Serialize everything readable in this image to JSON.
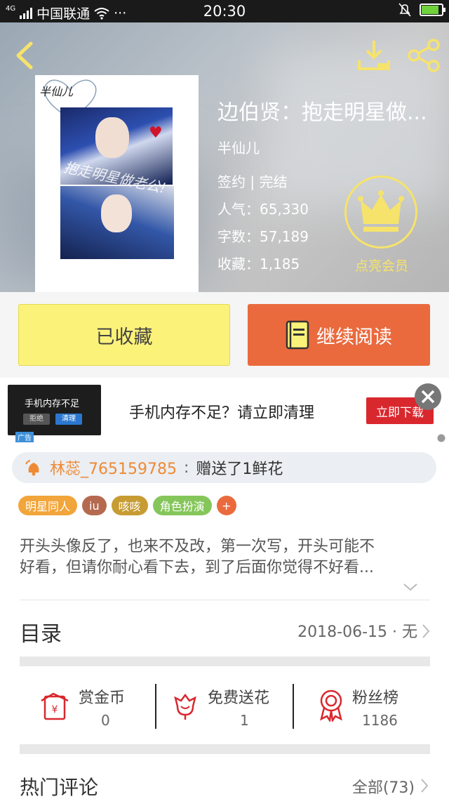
{
  "status_bar": {
    "carrier": "中国联通",
    "network": "4G",
    "time": "20:30",
    "dots": "···",
    "battery_level": 0.8
  },
  "book": {
    "title": "边伯贤：抱走明星做...",
    "author": "半仙儿",
    "status": "签约 | 完结",
    "popularity": "人气：65,330",
    "word_count": "字数：57,189",
    "favorites": "收藏：1,185",
    "cover_author": "半仙儿",
    "cover_overlay": "抱走明星做老公!"
  },
  "vip": {
    "label": "点亮会员",
    "color": "#f6e36b"
  },
  "actions": {
    "favorited_label": "已收藏",
    "continue_label": "继续阅读"
  },
  "ad": {
    "image_title": "手机内存不足",
    "image_btn_reject": "拒绝",
    "image_btn_clean": "清理",
    "tag": "广告",
    "text": "手机内存不足？请立即清理",
    "cta": "立即下载"
  },
  "gift": {
    "user": "林蕊_765159785",
    "separator": ":",
    "action": "赠送了1鲜花"
  },
  "tags": [
    {
      "label": "明星同人",
      "color": "#f2a53a"
    },
    {
      "label": "iu",
      "color": "#b56a4f"
    },
    {
      "label": "咳咳",
      "color": "#c79c33"
    },
    {
      "label": "角色扮演",
      "color": "#85c65a"
    },
    {
      "label": "+",
      "color": "#ea6a3e"
    }
  ],
  "description": {
    "line1": "开头头像反了，也来不及改，第一次写，开头可能不",
    "line2": "好看，但请你耐心看下去，到了后面你觉得不好看..."
  },
  "toc": {
    "title": "目录",
    "date": "2018-06-15 · 无"
  },
  "stats": [
    {
      "label": "赏金币",
      "value": "0",
      "icon": "coin-icon"
    },
    {
      "label": "免费送花",
      "value": "1",
      "icon": "flower-icon"
    },
    {
      "label": "粉丝榜",
      "value": "1186",
      "icon": "ribbon-icon"
    }
  ],
  "comments": {
    "title": "热门评论",
    "all_label": "全部(73)"
  },
  "colors": {
    "accent_orange": "#ea6a3e",
    "favorite_yellow": "#fbf27a",
    "icon_red": "#d9272e"
  }
}
